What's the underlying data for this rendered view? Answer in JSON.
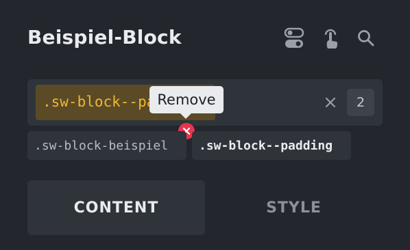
{
  "panel": {
    "title": "Beispiel-Block",
    "icons": [
      "toggle-icon",
      "touch-icon",
      "search-icon"
    ]
  },
  "selector": {
    "active_class": ".sw-block--padding",
    "tooltip": "Remove",
    "count": "2",
    "classes": [
      ".sw-block-beispiel",
      ".sw-block--padding"
    ]
  },
  "tabs": [
    {
      "label": "CONTENT",
      "active": true
    },
    {
      "label": "STYLE",
      "active": false
    }
  ],
  "colors": {
    "background": "#23272d",
    "accent": "#f2b634",
    "remove": "#e8344e"
  }
}
